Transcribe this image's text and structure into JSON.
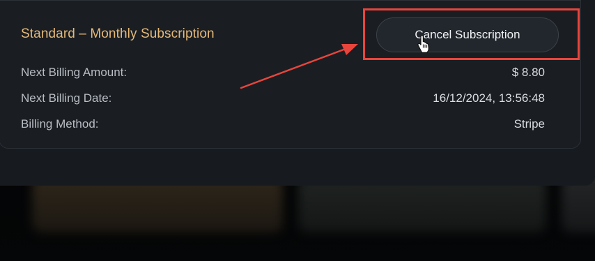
{
  "subscription": {
    "plan_title": "Standard – Monthly Subscription",
    "cancel_label": "Cancel Subscription",
    "rows": [
      {
        "label": "Next Billing Amount:",
        "value": "$ 8.80"
      },
      {
        "label": "Next Billing Date:",
        "value": "16/12/2024, 13:56:48"
      },
      {
        "label": "Billing Method:",
        "value": "Stripe"
      }
    ]
  },
  "colors": {
    "plan_title": "#e5b877",
    "highlight": "#e8453c",
    "panel": "#1a1e23"
  },
  "annotations": {
    "highlight_target": "cancel-subscription-button",
    "arrow_icon": "red-arrow-icon",
    "cursor_icon": "hand-pointer-icon"
  }
}
